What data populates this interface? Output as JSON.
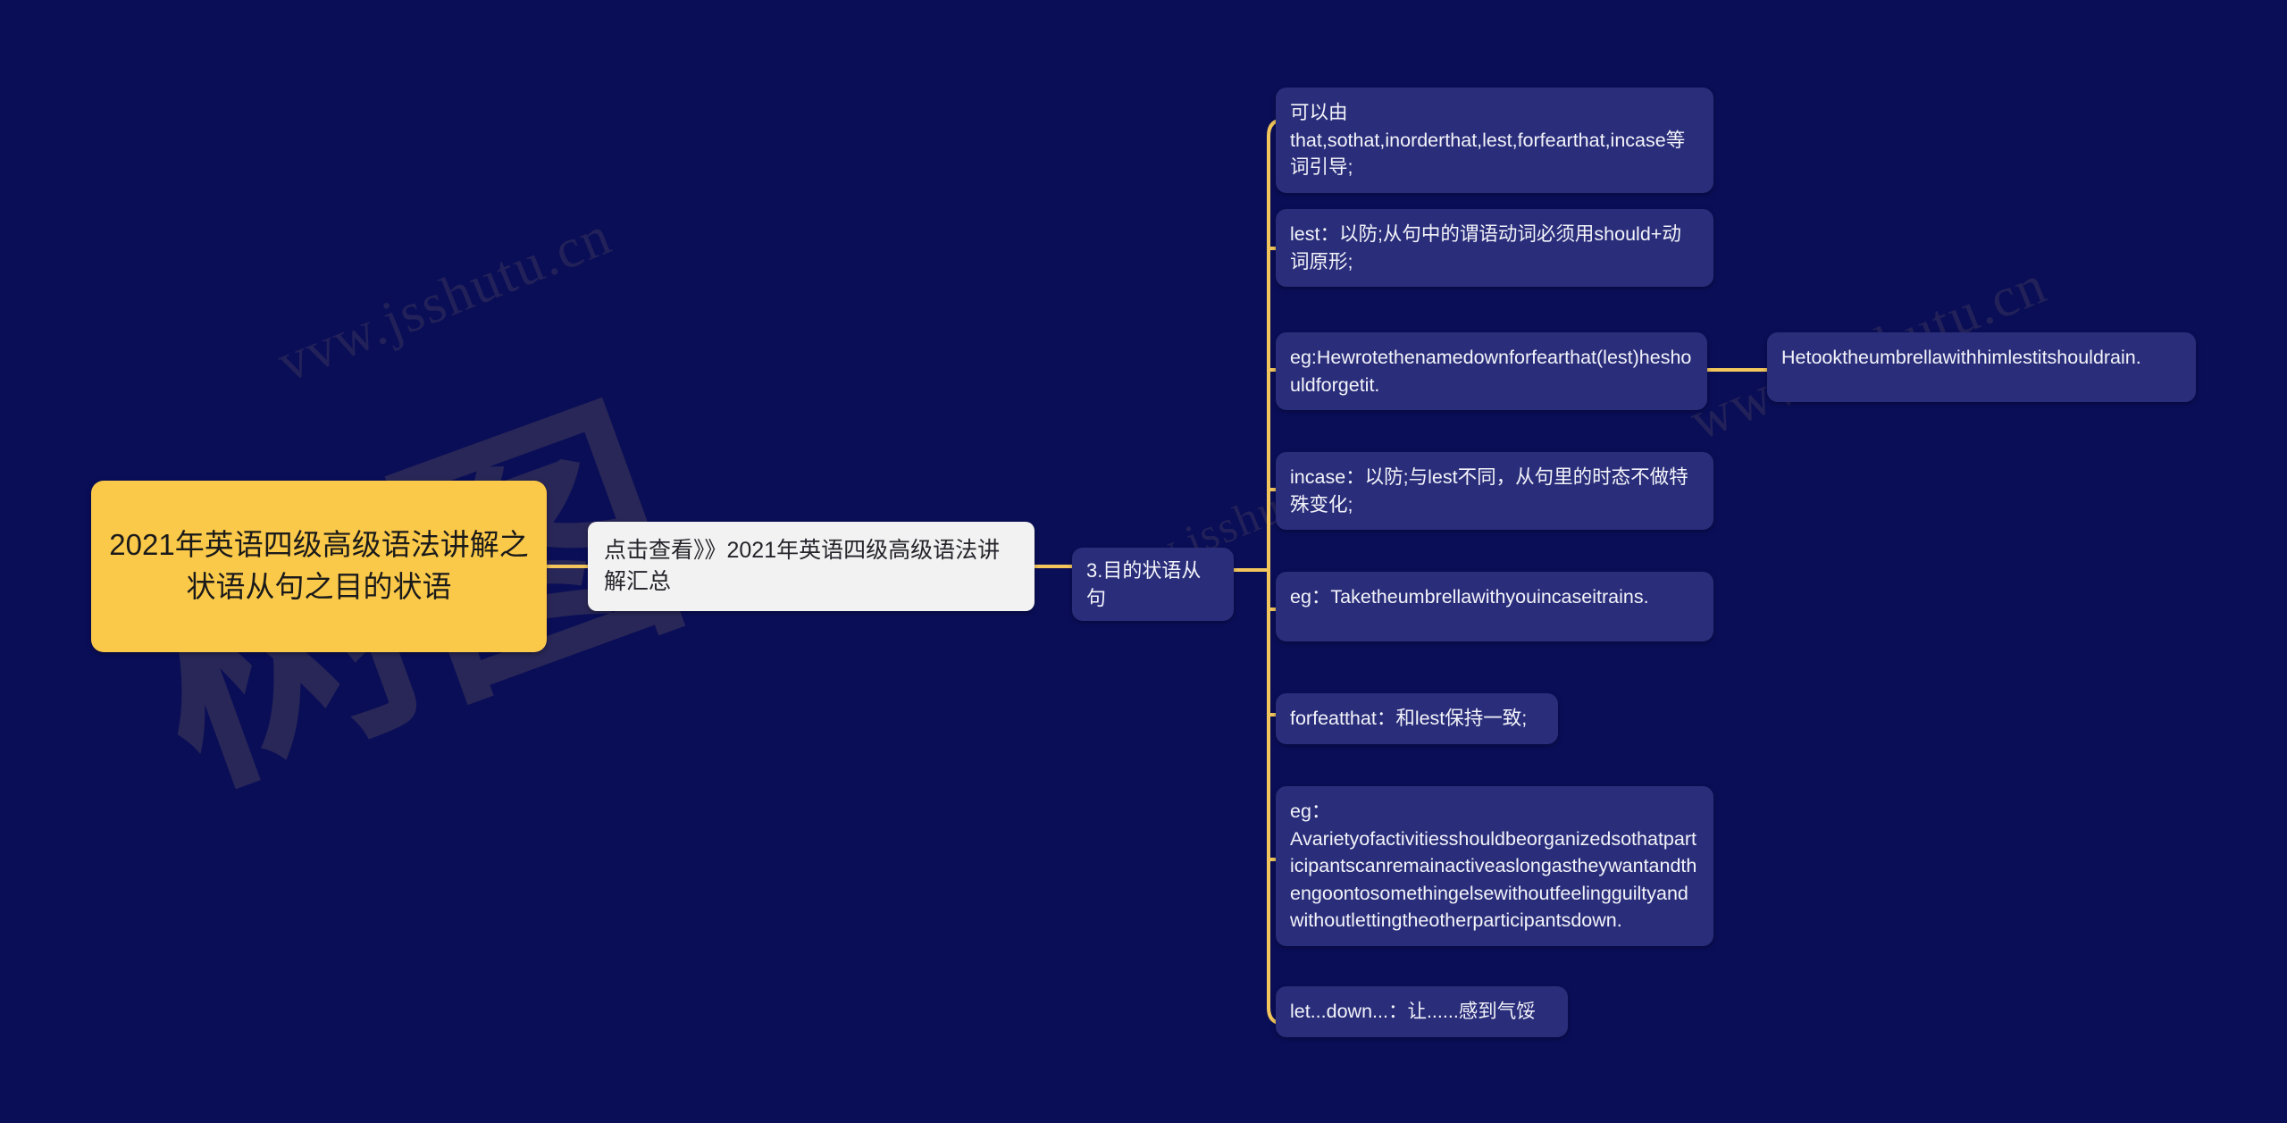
{
  "theme": {
    "background": "#0a0e57",
    "root_fill": "#fbc94a",
    "root_text": "#1a1a1a",
    "light_fill": "#f2f2f2",
    "light_text": "#24242b",
    "node_fill": "#2a2e7a",
    "node_text": "#f3f3fa",
    "connector": "#f2c65c"
  },
  "watermark": {
    "line1": "vvw.jsshutu.cn",
    "line2": "www.jsshutu.cn",
    "line3": "www.jsshutu.cn",
    "big": "树图"
  },
  "mindmap": {
    "root": {
      "label": "2021年英语四级高级语法讲解之状语从句之目的状语"
    },
    "link_node": {
      "label": "点击查看》》2021年英语四级高级语法讲解汇总"
    },
    "topic": {
      "label": "3.目的状语从句"
    },
    "branches": [
      {
        "id": "b1",
        "label": "可以由that,sothat,inorderthat,lest,forfearthat,incase等词引导;"
      },
      {
        "id": "b2",
        "label": "lest：以防;从句中的谓语动词必须用should+动词原形;"
      },
      {
        "id": "b3",
        "label": "eg:Hewrotethenamedownforfearthat(lest)heshouldforgetit."
      },
      {
        "id": "b4",
        "label": "incase：以防;与lest不同，从句里的时态不做特殊变化;"
      },
      {
        "id": "b5",
        "label": "eg：Taketheumbrellawithyouincaseitrains."
      },
      {
        "id": "b6",
        "label": "forfeatthat：和lest保持一致;"
      },
      {
        "id": "b7",
        "label": "eg：Avarietyofactivitiesshouldbeorganizedsothatparticipantscanremainactiveaslongastheywantandthengoontosomethingelsewithoutfeelingguiltyandwithoutlettingtheotherparticipantsdown."
      },
      {
        "id": "b8",
        "label": "let...down...：让......感到气馁"
      }
    ],
    "sub_branches": [
      {
        "id": "s1",
        "parent": "b3",
        "label": "Hetooktheumbrellawithhimlestitshouldrain."
      }
    ]
  }
}
